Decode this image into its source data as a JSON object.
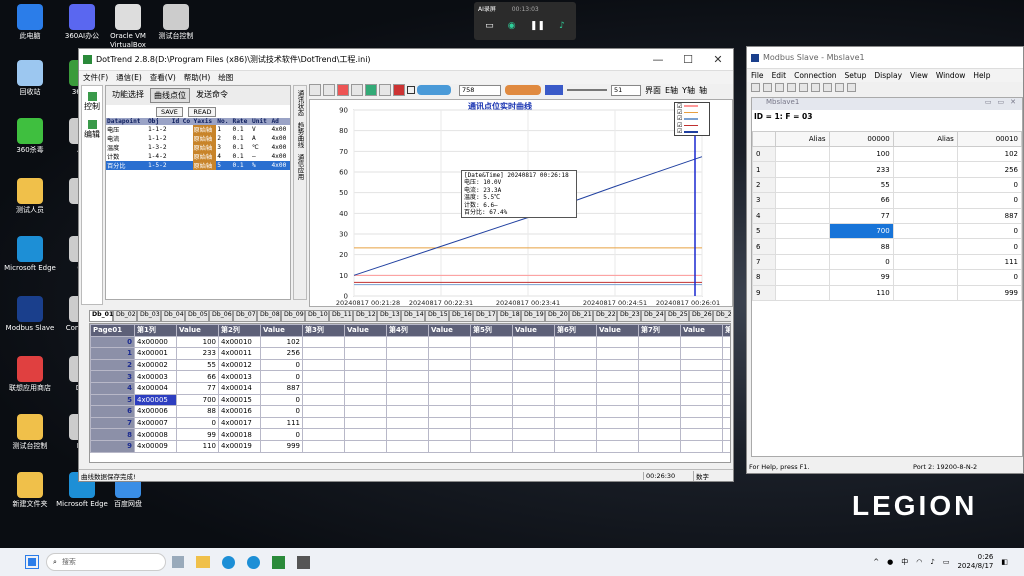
{
  "desktop": {
    "icons": [
      {
        "label": "此电脑",
        "color": "#2b7de9"
      },
      {
        "label": "360AI办公",
        "color": "#5a67f0"
      },
      {
        "label": "Oracle VM VirtualBox",
        "color": "#ddd"
      },
      {
        "label": "测试台控制",
        "color": "#ccc"
      },
      {
        "label": "回收站",
        "color": "#9cc7f0"
      },
      {
        "label": "360浏",
        "color": "#3b9b3b"
      },
      {
        "label": "360杀毒",
        "color": "#3fbf3f"
      },
      {
        "label": "AC",
        "color": "#ccc"
      },
      {
        "label": "测试人员",
        "color": "#f0c04a"
      },
      {
        "label": "Pi",
        "color": "#ccc"
      },
      {
        "label": "Microsoft Edge",
        "color": "#1d8fd6"
      },
      {
        "label": "Co",
        "color": "#ccc"
      },
      {
        "label": "Modbus Slave",
        "color": "#1a3f8c"
      },
      {
        "label": "Con Virtu",
        "color": "#ccc"
      },
      {
        "label": "联想应用商店",
        "color": "#e04040"
      },
      {
        "label": "Dot",
        "color": "#ccc"
      },
      {
        "label": "测试台控制",
        "color": "#f0c04a"
      },
      {
        "label": "Mb",
        "color": "#ccc"
      },
      {
        "label": "新建文件夹",
        "color": "#f0c04a"
      },
      {
        "label": "Microsoft Edge",
        "color": "#1d8fd6"
      },
      {
        "label": "百度网盘",
        "color": "#3a8ee6"
      }
    ],
    "brand": "LEGION"
  },
  "recorder": {
    "title": "AI录屏",
    "time": "00:13:03"
  },
  "dottrend": {
    "title": "DotTrend 2.8.8(D:\\Program Files (x86)\\测试技术软件\\DotTrend\\工程.ini)",
    "menu": [
      "文件(F)",
      "通信(E)",
      "查看(V)",
      "帮助(H)",
      "绘图"
    ],
    "side": [
      "控制",
      "编辑"
    ],
    "tabs": [
      "功能选择",
      "曲线点位",
      "发送命令"
    ],
    "save": "SAVE",
    "read": "READ",
    "dp_headers": [
      "Datapoint",
      "Obj",
      "Id",
      "Co",
      "Yaxis",
      "No.",
      "Rate",
      "Unit",
      "Ad"
    ],
    "dp_rows": [
      [
        "电压",
        "1-1-2",
        "",
        "",
        "原始轴",
        "1",
        "0.1",
        "V",
        "4x00"
      ],
      [
        "电流",
        "1-1-2",
        "",
        "",
        "原始轴",
        "2",
        "0.1",
        "A",
        "4x00"
      ],
      [
        "温度",
        "1-3-2",
        "",
        "",
        "原始轴",
        "3",
        "0.1",
        "℃",
        "4x00"
      ],
      [
        "计数",
        "1-4-2",
        "",
        "",
        "原始轴",
        "4",
        "0.1",
        "—",
        "4x00"
      ],
      [
        "百分比",
        "1-5-2",
        "",
        "",
        "原始轴",
        "5",
        "0.1",
        "%",
        "4x00"
      ]
    ],
    "vtabs": [
      "通讯状态",
      "趋势曲线",
      "通信应用"
    ],
    "toolbar": {
      "val1": "758",
      "val2": "51",
      "labels": [
        "界面",
        "E轴",
        "Y轴",
        "轴"
      ]
    },
    "chart_title": "通讯点位实时曲线",
    "tooltip": [
      "[Date&Time] 20240817 00:26:18",
      "电压: 10.0V",
      "电流: 23.3A",
      "温度: 5.5℃",
      "计数: 6.6—",
      "百分比: 67.4%"
    ],
    "sheet_tabs": [
      "Db_01",
      "Db_02",
      "Db_03",
      "Db_04",
      "Db_05",
      "Db_06",
      "Db_07",
      "Db_08",
      "Db_09",
      "Db_10",
      "Db_11",
      "Db_12",
      "Db_13",
      "Db_14",
      "Db_15",
      "Db_16",
      "Db_17",
      "Db_18",
      "Db_19",
      "Db_20",
      "Db_21",
      "Db_22",
      "Db_23",
      "Db_24",
      "Db_25",
      "Db_26",
      "Db_27"
    ],
    "grid_headers": [
      "Page01",
      "第1列",
      "Value",
      "第2列",
      "Value",
      "第3列",
      "Value",
      "第4列",
      "Value",
      "第5列",
      "Value",
      "第6列",
      "Value",
      "第7列",
      "Value",
      "第8列"
    ],
    "grid_rows": [
      [
        "0",
        "4x00000",
        "100",
        "4x00010",
        "102"
      ],
      [
        "1",
        "4x00001",
        "233",
        "4x00011",
        "256"
      ],
      [
        "2",
        "4x00002",
        "55",
        "4x00012",
        "0"
      ],
      [
        "3",
        "4x00003",
        "66",
        "4x00013",
        "0"
      ],
      [
        "4",
        "4x00004",
        "77",
        "4x00014",
        "887"
      ],
      [
        "5",
        "4x00005",
        "700",
        "4x00015",
        "0"
      ],
      [
        "6",
        "4x00006",
        "88",
        "4x00016",
        "0"
      ],
      [
        "7",
        "4x00007",
        "0",
        "4x00017",
        "111"
      ],
      [
        "8",
        "4x00008",
        "99",
        "4x00018",
        "0"
      ],
      [
        "9",
        "4x00009",
        "110",
        "4x00019",
        "999"
      ]
    ],
    "status": [
      "曲线数据保存完成!",
      "00:26:30",
      "数字"
    ]
  },
  "chart_data": {
    "type": "line",
    "title": "通讯点位实时曲线",
    "x_ticks": [
      "20240817 00:21:28",
      "20240817 00:22:31",
      "20240817 00:23:41",
      "20240817 00:24:51",
      "20240817 00:26:01"
    ],
    "ylim": [
      0,
      90
    ],
    "y_ticks": [
      0,
      10,
      20,
      30,
      40,
      50,
      60,
      70,
      80,
      90
    ],
    "series": [
      {
        "name": "电压",
        "color": "#ff9999",
        "values": [
          10,
          10,
          10,
          10,
          10
        ]
      },
      {
        "name": "电流",
        "color": "#e8a040",
        "values": [
          23.3,
          23.3,
          23.3,
          23.3,
          23.3
        ]
      },
      {
        "name": "温度",
        "color": "#7aa0d0",
        "values": [
          5.5,
          5.5,
          5.5,
          5.5,
          5.5
        ]
      },
      {
        "name": "计数",
        "color": "#c03030",
        "values": [
          6.6,
          6.6,
          6.6,
          6.6,
          6.6
        ]
      },
      {
        "name": "百分比",
        "color": "#2040a0",
        "values": [
          10,
          24,
          38,
          53,
          67.4
        ]
      }
    ]
  },
  "modbus": {
    "title": "Modbus Slave - Mbslave1",
    "menu": [
      "File",
      "Edit",
      "Connection",
      "Setup",
      "Display",
      "View",
      "Window",
      "Help"
    ],
    "child": "Mbslave1",
    "id_line": "ID = 1: F = 03",
    "headers": [
      "",
      "Alias",
      "00000",
      "Alias",
      "00010"
    ],
    "rows": [
      [
        "0",
        "",
        "100",
        "",
        "102"
      ],
      [
        "1",
        "",
        "233",
        "",
        "256"
      ],
      [
        "2",
        "",
        "55",
        "",
        "0"
      ],
      [
        "3",
        "",
        "66",
        "",
        "0"
      ],
      [
        "4",
        "",
        "77",
        "",
        "887"
      ],
      [
        "5",
        "",
        "700",
        "",
        "0"
      ],
      [
        "6",
        "",
        "88",
        "",
        "0"
      ],
      [
        "7",
        "",
        "0",
        "",
        "111"
      ],
      [
        "8",
        "",
        "99",
        "",
        "0"
      ],
      [
        "9",
        "",
        "110",
        "",
        "999"
      ]
    ],
    "status_left": "For Help, press F1.",
    "status_right": "Port 2: 19200-8-N-2"
  },
  "taskbar": {
    "search": "搜索",
    "time": "0:26",
    "date": "2024/8/17",
    "lang": "中"
  }
}
